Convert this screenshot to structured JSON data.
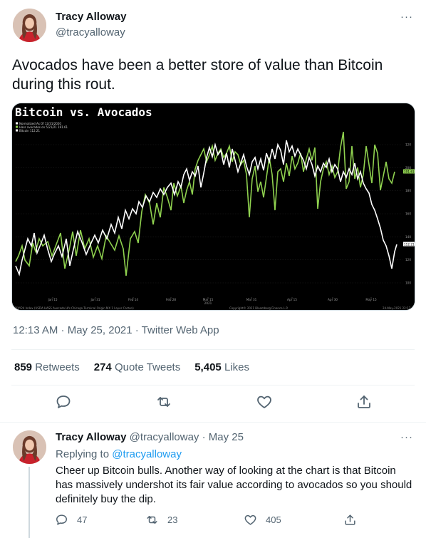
{
  "tweet": {
    "display_name": "Tracy Alloway",
    "handle": "@tracyalloway",
    "more_label": "···",
    "text": "Avocados have been a better store of value than Bitcoin during this rout.",
    "timestamp": "12:13 AM · May 25, 2021 · Twitter Web App",
    "stats": {
      "retweets_count": "859",
      "retweets_label": "Retweets",
      "quote_count": "274",
      "quote_label": "Quote Tweets",
      "likes_count": "5,405",
      "likes_label": "Likes"
    }
  },
  "chart": {
    "title": "Bitcoin vs. Avocados",
    "legend": [
      {
        "label": "Normalized As Of 12/31/2020",
        "color": "#ffffff"
      },
      {
        "label": "Hass avocados on 5/21/21 191.61",
        "color": "#8fd14f"
      },
      {
        "label": "Bitcoin 112.21",
        "color": "#ffffff"
      }
    ],
    "x_ticks": [
      "Jan 15",
      "Jan 31",
      "Feb 14",
      "Feb 28",
      "Mar 15\n2021",
      "Mar 31",
      "Apr 15",
      "Apr 30",
      "May 15"
    ],
    "y_ticks": [
      "120",
      "200",
      "180",
      "160",
      "140",
      "120",
      "100"
    ],
    "footer_left": "DXY24 Index (USDA HASS Avocado Hfs Chicago Terminal Origin MX 1 Layer Carton)",
    "footer_mid": "Copyright© 2021 Bloomberg Finance L.P.",
    "footer_right": "24-May-2021 22:17",
    "last_avocado": "191.61",
    "last_bitcoin": "112.21",
    "colors": {
      "avocado": "#8fd14f",
      "bitcoin": "#ffffff",
      "bg": "#000000"
    }
  },
  "reply": {
    "display_name": "Tracy Alloway",
    "handle": "@tracyalloway",
    "date": "· May 25",
    "more_label": "···",
    "replying_prefix": "Replying to",
    "replying_to": "@tracyalloway",
    "text": "Cheer up Bitcoin bulls. Another way of looking at the chart is that Bitcoin has massively undershot its fair value according to avocados so you should definitely buy the dip.",
    "reply_count": "47",
    "retweet_count": "23",
    "like_count": "405"
  }
}
